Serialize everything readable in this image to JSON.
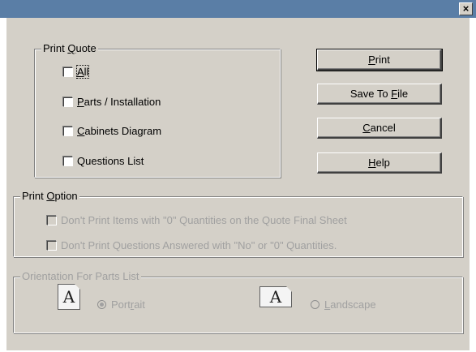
{
  "window": {
    "close_glyph": "×"
  },
  "print_quote": {
    "legend_pre": "Print ",
    "legend_mn": "Q",
    "legend_post": "uote",
    "items": [
      {
        "pre": "",
        "mn": "A",
        "post": "ll"
      },
      {
        "pre": "",
        "mn": "P",
        "post": "arts / Installation"
      },
      {
        "pre": "",
        "mn": "C",
        "post": "abinets Diagram"
      },
      {
        "pre": "",
        "mn": "",
        "post": "Questions List"
      }
    ]
  },
  "buttons": {
    "print": {
      "pre": "",
      "mn": "P",
      "post": "rint"
    },
    "save": {
      "pre": "Save To ",
      "mn": "F",
      "post": "ile"
    },
    "cancel": {
      "pre": "",
      "mn": "C",
      "post": "ancel"
    },
    "help": {
      "pre": "",
      "mn": "H",
      "post": "elp"
    }
  },
  "print_option": {
    "legend_pre": "Print ",
    "legend_mn": "O",
    "legend_post": "ption",
    "items": [
      "Don't Print Items with \"0\" Quantities on the Quote Final Sheet",
      "Don't Print Questions Answered with \"No\" or \"0\" Quantities."
    ]
  },
  "orientation": {
    "legend": "Orientation For Parts List",
    "icon_letter": "A",
    "portrait": {
      "pre": "Port",
      "mn": "r",
      "post": "ait"
    },
    "landscape": {
      "pre": "",
      "mn": "L",
      "post": "andscape"
    }
  }
}
